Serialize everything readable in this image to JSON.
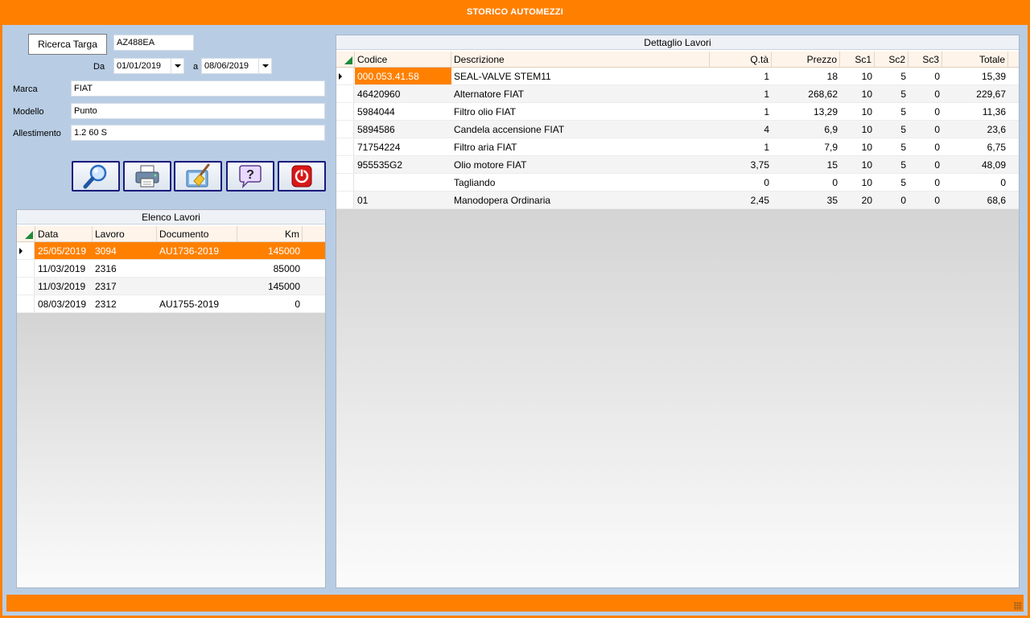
{
  "window": {
    "title": "STORICO AUTOMEZZI"
  },
  "search": {
    "button_label": "Ricerca Targa",
    "targa": "AZ488EA",
    "da_label": "Da",
    "da_value": "01/01/2019",
    "a_label": "a",
    "a_value": "08/06/2019"
  },
  "vehicle": {
    "marca_label": "Marca",
    "marca": "FIAT",
    "modello_label": "Modello",
    "modello": "Punto",
    "allestimento_label": "Allestimento",
    "allestimento": "1.2 60 S"
  },
  "toolbar": {
    "buttons": [
      "search-icon",
      "printer-icon",
      "clean-broom-icon",
      "help-icon",
      "power-exit-icon"
    ]
  },
  "elenco": {
    "title": "Elenco Lavori",
    "columns": [
      "Data",
      "Lavoro",
      "Documento",
      "Km"
    ],
    "rows": [
      {
        "data": "25/05/2019",
        "lavoro": "3094",
        "documento": "AU1736-2019",
        "km": "145000"
      },
      {
        "data": "11/03/2019",
        "lavoro": "2316",
        "documento": "",
        "km": "85000"
      },
      {
        "data": "11/03/2019",
        "lavoro": "2317",
        "documento": "",
        "km": "145000"
      },
      {
        "data": "08/03/2019",
        "lavoro": "2312",
        "documento": "AU1755-2019",
        "km": "0"
      }
    ]
  },
  "dettaglio": {
    "title": "Dettaglio Lavori",
    "columns": [
      "Codice",
      "Descrizione",
      "Q.tà",
      "Prezzo",
      "Sc1",
      "Sc2",
      "Sc3",
      "Totale"
    ],
    "rows": [
      {
        "codice": "000.053.41.58",
        "descrizione": "SEAL-VALVE STEM11",
        "qta": "1",
        "prezzo": "18",
        "sc1": "10",
        "sc2": "5",
        "sc3": "0",
        "totale": "15,39"
      },
      {
        "codice": "46420960",
        "descrizione": "Alternatore FIAT",
        "qta": "1",
        "prezzo": "268,62",
        "sc1": "10",
        "sc2": "5",
        "sc3": "0",
        "totale": "229,67"
      },
      {
        "codice": "5984044",
        "descrizione": "Filtro olio FIAT",
        "qta": "1",
        "prezzo": "13,29",
        "sc1": "10",
        "sc2": "5",
        "sc3": "0",
        "totale": "11,36"
      },
      {
        "codice": "5894586",
        "descrizione": "Candela accensione FIAT",
        "qta": "4",
        "prezzo": "6,9",
        "sc1": "10",
        "sc2": "5",
        "sc3": "0",
        "totale": "23,6"
      },
      {
        "codice": "71754224",
        "descrizione": "Filtro aria FIAT",
        "qta": "1",
        "prezzo": "7,9",
        "sc1": "10",
        "sc2": "5",
        "sc3": "0",
        "totale": "6,75"
      },
      {
        "codice": "955535G2",
        "descrizione": "Olio motore FIAT",
        "qta": "3,75",
        "prezzo": "15",
        "sc1": "10",
        "sc2": "5",
        "sc3": "0",
        "totale": "48,09"
      },
      {
        "codice": "",
        "descrizione": "Tagliando",
        "qta": "0",
        "prezzo": "0",
        "sc1": "10",
        "sc2": "5",
        "sc3": "0",
        "totale": "0"
      },
      {
        "codice": "01",
        "descrizione": "Manodopera Ordinaria",
        "qta": "2,45",
        "prezzo": "35",
        "sc1": "20",
        "sc2": "0",
        "sc3": "0",
        "totale": "68,6"
      }
    ]
  },
  "colors": {
    "accent": "#ff8000",
    "background": "#b8cde4",
    "button_border": "#1a1a7a"
  }
}
